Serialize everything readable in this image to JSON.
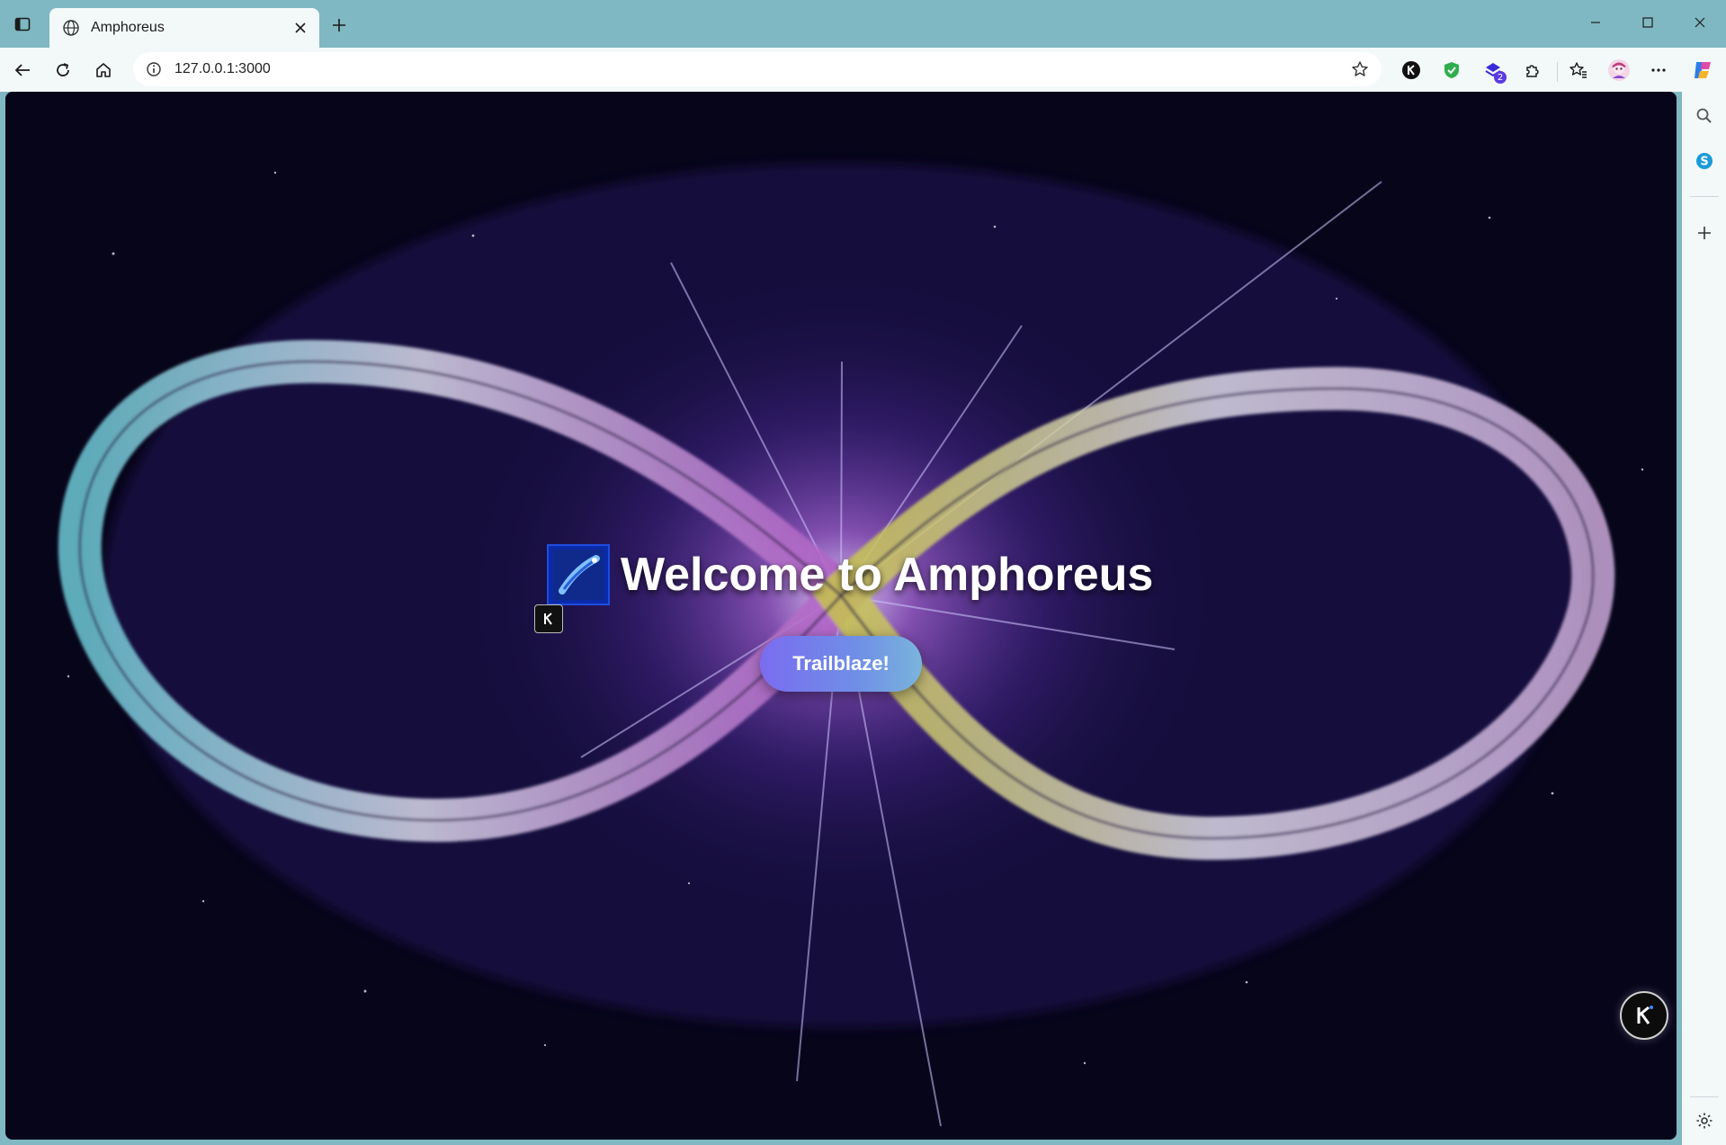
{
  "browser": {
    "tab": {
      "title": "Amphoreus"
    },
    "address_bar": {
      "url": "127.0.0.1:3000"
    },
    "extensions": [
      {
        "name": "k-extension-icon"
      },
      {
        "name": "shield-extension-icon"
      },
      {
        "name": "stack-extension-icon",
        "badge": "2"
      },
      {
        "name": "puzzle-extensions-icon"
      }
    ]
  },
  "page": {
    "title": "Welcome to Amphoreus",
    "button_label": "Trailblaze!"
  },
  "colors": {
    "accent_button_start": "#7a6cf0",
    "accent_button_end": "#7ab4dc",
    "titlebar": "#7fb8c2",
    "toolbar": "#f3f8f9"
  }
}
